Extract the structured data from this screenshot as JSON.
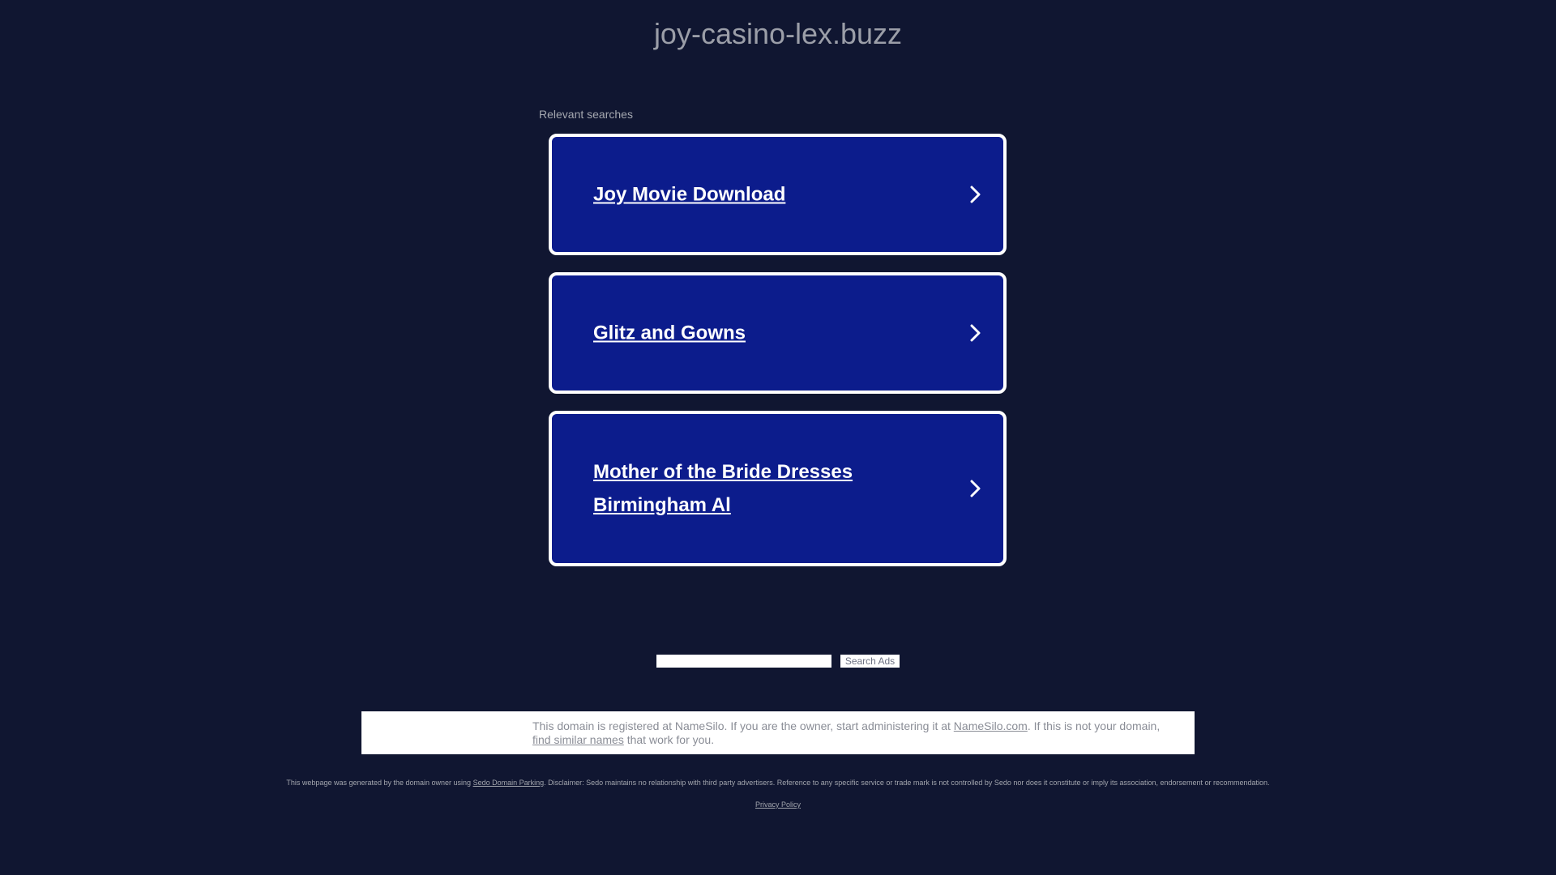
{
  "header": {
    "domain_title": "joy-casino-lex.buzz"
  },
  "results": {
    "section_label": "Relevant searches",
    "items": [
      {
        "label": "Joy Movie Download",
        "icon": "chevron-right-icon"
      },
      {
        "label": "Glitz and Gowns",
        "icon": "chevron-right-icon"
      },
      {
        "label": "Mother of the Bride Dresses Birmingham Al",
        "icon": "chevron-right-icon"
      }
    ]
  },
  "search": {
    "input_value": "",
    "button_label": "Search Ads"
  },
  "notice": {
    "text_before": "This domain is registered at NameSilo. If you are the owner, start administering it at ",
    "link_namesilo": "NameSilo.com",
    "text_middle": ". If this is not your domain, ",
    "link_similar": "find similar names",
    "text_after": " that work for you."
  },
  "footer": {
    "disclaimer_before": "This webpage was generated by the domain owner using ",
    "disclaimer_link": "Sedo Domain Parking",
    "disclaimer_after": ". Disclaimer: Sedo maintains no relationship with third party advertisers. Reference to any specific service or trade mark is not controlled by Sedo nor does it constitute or imply its association, endorsement or recommendation.",
    "privacy_label": "Privacy Policy"
  },
  "colors": {
    "background": "#101631",
    "card_fill": "#0c1c8c",
    "card_border": "#ffffff",
    "title_text": "#9b9ea8"
  }
}
